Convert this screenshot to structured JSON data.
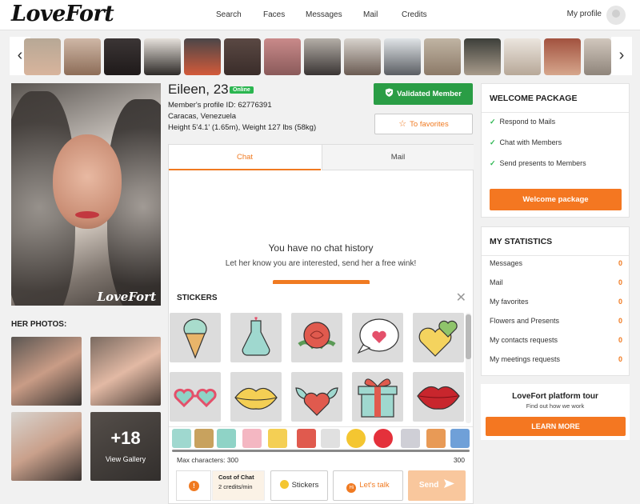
{
  "brand": {
    "logo": "LoveFort",
    "watermark": "LoveFort",
    "accent": "#f07a21",
    "green": "#2a9d45"
  },
  "nav": {
    "items": [
      "Search",
      "Faces",
      "Messages",
      "Mail",
      "Credits"
    ],
    "my_profile": "My profile"
  },
  "carousel": {
    "prev_icon": "chevron-left-icon",
    "next_icon": "chevron-right-icon",
    "prev": "‹",
    "next": "›"
  },
  "profile": {
    "name": "Eileen, 23",
    "status": "Online",
    "id_line": "Member's profile ID: 62776391",
    "location": "Caracas, Venezuela",
    "measurements": "Height 5'4.1' (1.65m), Weight 127 lbs (58kg)",
    "validated_label": "Validated Member",
    "favorites_label": "To favorites"
  },
  "photos": {
    "title": "HER PHOTOS:",
    "more_count": "+18",
    "more_label": "View Gallery"
  },
  "chat": {
    "tabs": [
      "Chat",
      "Mail"
    ],
    "empty_title": "You have no chat history",
    "empty_sub": "Let her know you are interested, send her a free wink!",
    "stickers_title": "STICKERS",
    "close": "✕",
    "stickers": [
      "ice-cream",
      "potion-bottle",
      "rose",
      "heart-speech-bubble",
      "hearts",
      "heart-glasses",
      "lips",
      "winged-heart",
      "gift-box",
      "kiss-lips"
    ],
    "max_chars_label": "Max characters: 300",
    "max_chars_count": "300",
    "info_icon": "!",
    "cost_title": "Cost of Chat",
    "cost_value": "2 credits/min",
    "stickers_btn": "Stickers",
    "lets_talk_btn": "Let's talk",
    "send_btn": "Send"
  },
  "welcome": {
    "title": "WELCOME PACKAGE",
    "perks": [
      "Respond to Mails",
      "Chat with Members",
      "Send presents to Members"
    ],
    "button": "Welcome package"
  },
  "stats": {
    "title": "MY STATISTICS",
    "rows": [
      {
        "label": "Messages",
        "value": "0"
      },
      {
        "label": "Mail",
        "value": "0"
      },
      {
        "label": "My favorites",
        "value": "0"
      },
      {
        "label": "Flowers and Presents",
        "value": "0"
      },
      {
        "label": "My contacts requests",
        "value": "0"
      },
      {
        "label": "My meetings requests",
        "value": "0"
      }
    ]
  },
  "tour": {
    "title": "LoveFort platform tour",
    "subtitle": "Find out how we work",
    "button": "LEARN MORE"
  }
}
